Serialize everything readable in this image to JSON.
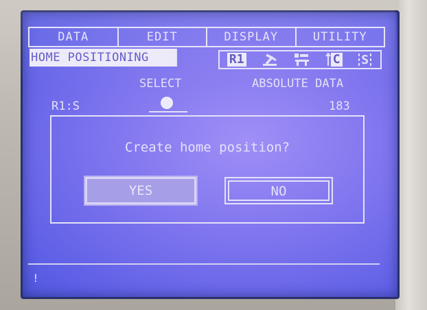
{
  "menu": {
    "tabs": [
      "DATA",
      "EDIT",
      "DISPLAY",
      "UTILITY"
    ]
  },
  "screen": {
    "title": "HOME POSITIONING"
  },
  "status": {
    "robot": "R1",
    "coord_indicator": "C",
    "security_indicator": "S",
    "icons": [
      "robot-arm-icon",
      "teach-mode-icon",
      "coordinate-icon",
      "security-icon"
    ]
  },
  "table": {
    "col_select": "SELECT",
    "col_absolute": "ABSOLUTE DATA",
    "rows": [
      {
        "axis": "R1:S",
        "value": "183"
      }
    ]
  },
  "dialog": {
    "message": "Create home position?",
    "yes_label": "YES",
    "no_label": "NO"
  },
  "message_line": {
    "indicator": "!"
  },
  "colors": {
    "screen_bg": "#7e74ee",
    "lcd_text": "#e4e2f8",
    "highlight": "#a79ee8"
  }
}
